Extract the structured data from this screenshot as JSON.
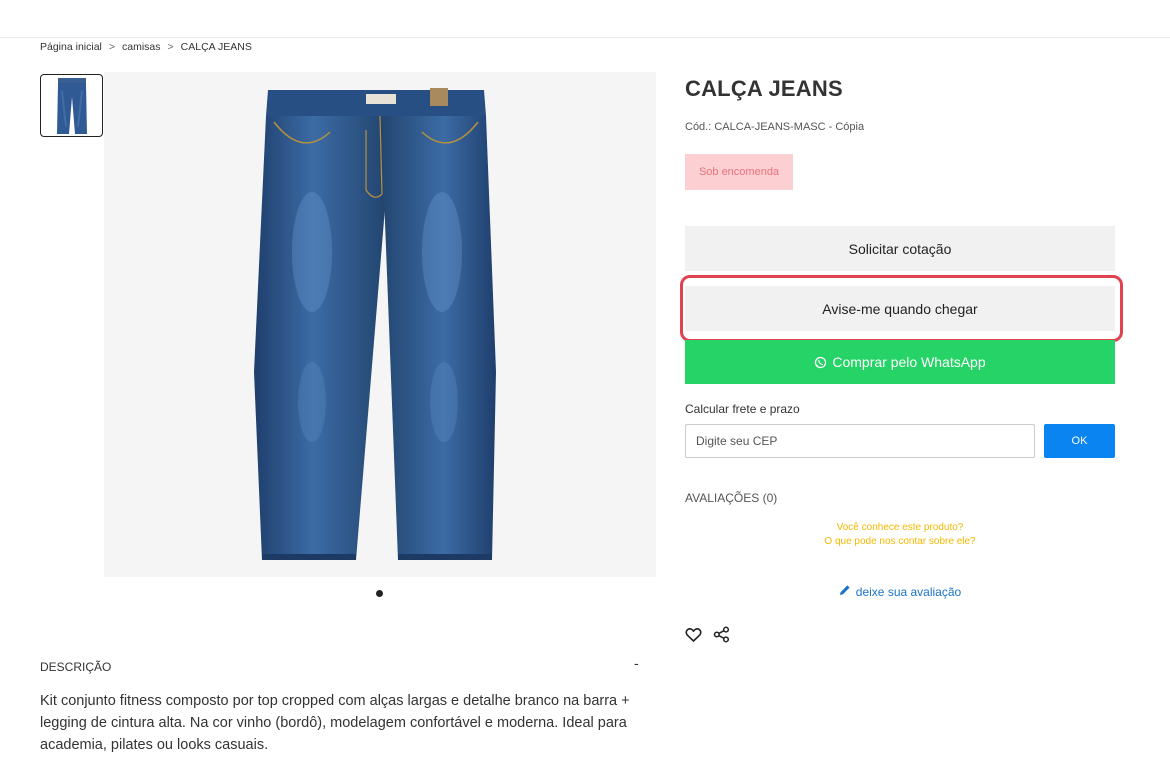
{
  "breadcrumb": {
    "home": "Página inicial",
    "category": "camisas",
    "current": "CALÇA JEANS",
    "separator": ">"
  },
  "gallery": {
    "image_icon": "jeans-product-photo",
    "thumb_icon": "jeans-thumbnail",
    "slide_count": 1
  },
  "product": {
    "title": "CALÇA JEANS",
    "code": "Cód.: CALCA-JEANS-MASC - Cópia",
    "badge": "Sob encomenda"
  },
  "actions": {
    "quote_label": "Solicitar cotação",
    "notify_label": "Avise-me quando chegar",
    "whatsapp_label": "Comprar pelo WhatsApp",
    "whatsapp_icon": "whatsapp-icon"
  },
  "shipping": {
    "label": "Calcular frete e prazo",
    "placeholder": "Digite seu CEP",
    "ok_label": "OK"
  },
  "reviews": {
    "title": "AVALIAÇÕES (0)",
    "prompt_line1": "Você conhece este produto?",
    "prompt_line2": "O que pode nos contar sobre ele?",
    "link_label": "deixe sua avaliação",
    "link_icon": "pencil-icon"
  },
  "social": {
    "wishlist_icon": "heart-icon",
    "share_icon": "share-icon"
  },
  "description": {
    "header": "DESCRIÇÃO",
    "toggle": "-",
    "text": "Kit conjunto fitness composto por top cropped com alças largas e detalhe branco na barra + legging de cintura alta. Na cor vinho (bordô), modelagem confortável e moderna. Ideal para academia, pilates ou looks casuais."
  },
  "colors": {
    "whatsapp": "#25d366",
    "ok_button": "#0a84f0",
    "badge_bg": "#fcd0d3",
    "badge_text": "#e8717a",
    "highlight": "#e0434f",
    "review_prompt": "#f5b800",
    "review_link": "#1a73c9"
  }
}
